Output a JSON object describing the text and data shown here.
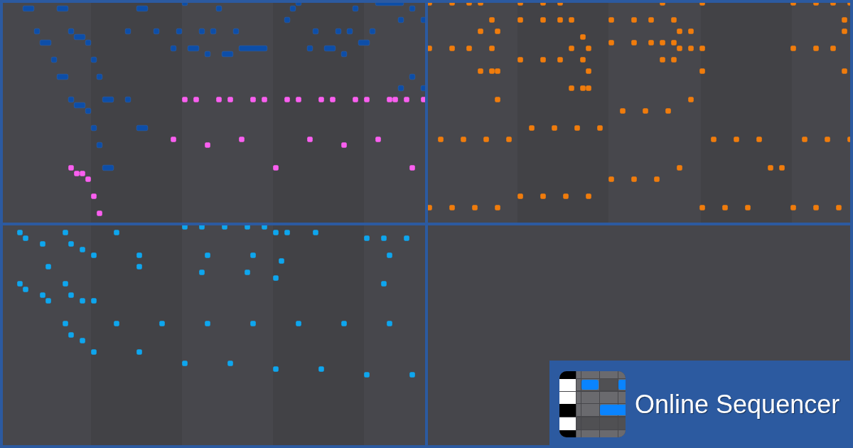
{
  "logo": {
    "title": "Online Sequencer"
  }
}
